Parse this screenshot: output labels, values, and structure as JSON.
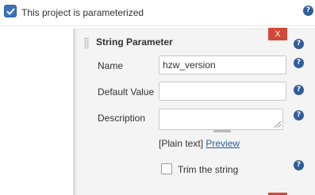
{
  "project": {
    "parameterized_label": "This project is parameterized",
    "parameterized_checked": true
  },
  "parameter": {
    "title": "String Parameter",
    "delete_label": "X",
    "name_label": "Name",
    "name_value": "hzw_version",
    "default_label": "Default Value",
    "default_value": "",
    "description_label": "Description",
    "description_value": "",
    "format_text": "[Plain text]",
    "preview_link": "Preview",
    "trim_label": "Trim the string",
    "trim_checked": false
  },
  "help_glyph": "?",
  "colors": {
    "accent": "#3b73b9",
    "help": "#2f5e9c",
    "danger": "#d24939",
    "link": "#2a5d9f"
  }
}
